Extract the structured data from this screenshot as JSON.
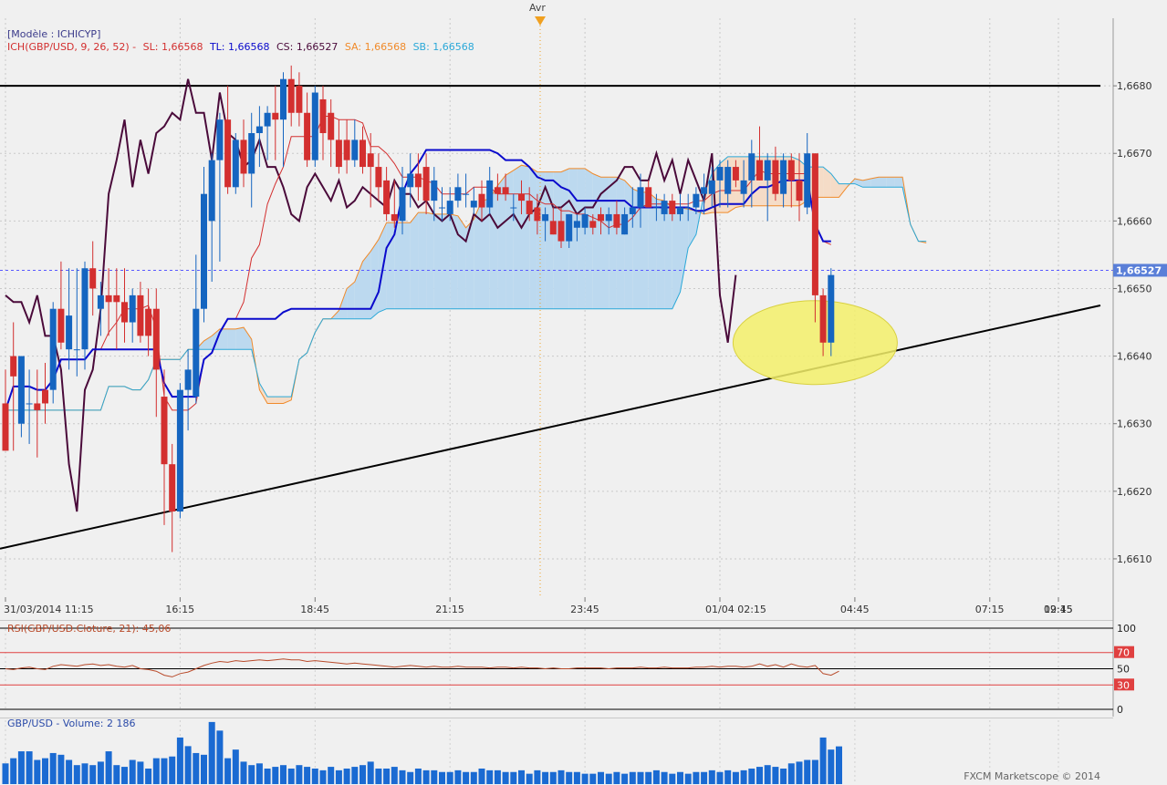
{
  "header": {
    "month_marker": "Avr",
    "model_label": "[Modèle : ICHICYP]",
    "ichimoku_legend": {
      "name": "ICH(GBP/USD, 9, 26, 52) -",
      "sl": "SL: 1,66568",
      "tl": "TL: 1,66568",
      "cs": "CS: 1,66527",
      "sa": "SA: 1,66568",
      "sb": "SB: 1,66568"
    }
  },
  "colors": {
    "bull": "#1565c0",
    "bear": "#d32f2f",
    "sl": "#d32f2f",
    "tl": "#0a0acc",
    "cs": "#4a0a3a",
    "sa": "#f08a2a",
    "sb": "#2aa8d8",
    "cloud_bull": "#bcd9ef",
    "cloud_bear": "#f5dcc7",
    "highlight": "#f3f06a",
    "rsi": "#b84a2a",
    "volume": "#1a6ad2"
  },
  "chart_data": [
    {
      "type": "candlestick",
      "title": "GBP/USD",
      "ylim": [
        1.6605,
        1.669
      ],
      "y_ticks": [
        "1,6610",
        "1,6620",
        "1,6630",
        "1,6640",
        "1,6650",
        "1,6660",
        "1,6670",
        "1,6680"
      ],
      "x_tick_labels": [
        "31/03/2014 11:15",
        "16:15",
        "18:45",
        "21:15",
        "23:45",
        "01/04 02:15",
        "04:45",
        "07:15",
        "09:45",
        "12:15"
      ],
      "current_price_label": "1,66527",
      "current_price": 1.66527,
      "ohlc": [
        [
          1.6633,
          1.6638,
          1.6626,
          1.6626
        ],
        [
          1.664,
          1.6645,
          1.6626,
          1.6637
        ],
        [
          1.663,
          1.664,
          1.6628,
          1.664
        ],
        [
          1.6633,
          1.6638,
          1.6627,
          1.6633
        ],
        [
          1.6633,
          1.6638,
          1.6625,
          1.6632
        ],
        [
          1.6635,
          1.6639,
          1.663,
          1.6633
        ],
        [
          1.6635,
          1.6648,
          1.6633,
          1.6647
        ],
        [
          1.6647,
          1.6654,
          1.6641,
          1.6642
        ],
        [
          1.6641,
          1.6653,
          1.6638,
          1.6646
        ],
        [
          1.6641,
          1.6653,
          1.6637,
          1.6641
        ],
        [
          1.6641,
          1.6654,
          1.6638,
          1.6653
        ],
        [
          1.6653,
          1.6657,
          1.6646,
          1.665
        ],
        [
          1.6647,
          1.6651,
          1.6643,
          1.6649
        ],
        [
          1.6649,
          1.6653,
          1.6643,
          1.6648
        ],
        [
          1.6649,
          1.6653,
          1.6641,
          1.6648
        ],
        [
          1.6648,
          1.6653,
          1.6642,
          1.6645
        ],
        [
          1.6645,
          1.665,
          1.6642,
          1.6649
        ],
        [
          1.6649,
          1.6651,
          1.6642,
          1.6643
        ],
        [
          1.6647,
          1.665,
          1.664,
          1.6643
        ],
        [
          1.6647,
          1.665,
          1.6631,
          1.6638
        ],
        [
          1.6634,
          1.6638,
          1.6615,
          1.6624
        ],
        [
          1.6624,
          1.6627,
          1.6611,
          1.6617
        ],
        [
          1.6617,
          1.6636,
          1.6616,
          1.6635
        ],
        [
          1.6635,
          1.6641,
          1.6629,
          1.6638
        ],
        [
          1.6634,
          1.6655,
          1.6633,
          1.6647
        ],
        [
          1.6647,
          1.6668,
          1.6645,
          1.6664
        ],
        [
          1.666,
          1.667,
          1.6651,
          1.6669
        ],
        [
          1.6669,
          1.6676,
          1.6654,
          1.6675
        ],
        [
          1.6675,
          1.668,
          1.6664,
          1.6665
        ],
        [
          1.6665,
          1.6673,
          1.6664,
          1.6672
        ],
        [
          1.6672,
          1.6675,
          1.6665,
          1.6667
        ],
        [
          1.6667,
          1.6676,
          1.6662,
          1.6673
        ],
        [
          1.6673,
          1.6677,
          1.6668,
          1.6674
        ],
        [
          1.6674,
          1.6677,
          1.6669,
          1.6676
        ],
        [
          1.6676,
          1.668,
          1.6669,
          1.6675
        ],
        [
          1.6675,
          1.6682,
          1.6668,
          1.6681
        ],
        [
          1.6681,
          1.6683,
          1.6674,
          1.6676
        ],
        [
          1.668,
          1.6682,
          1.6674,
          1.6676
        ],
        [
          1.6676,
          1.6679,
          1.6668,
          1.6669
        ],
        [
          1.6669,
          1.668,
          1.6668,
          1.6679
        ],
        [
          1.6678,
          1.668,
          1.6669,
          1.6673
        ],
        [
          1.6676,
          1.6678,
          1.6668,
          1.6672
        ],
        [
          1.6672,
          1.6675,
          1.6667,
          1.6668
        ],
        [
          1.6672,
          1.6675,
          1.6667,
          1.6669
        ],
        [
          1.6669,
          1.6675,
          1.6668,
          1.6672
        ],
        [
          1.6672,
          1.6674,
          1.6667,
          1.6668
        ],
        [
          1.667,
          1.6673,
          1.6662,
          1.6668
        ],
        [
          1.6668,
          1.667,
          1.6663,
          1.6665
        ],
        [
          1.6666,
          1.6668,
          1.666,
          1.6661
        ],
        [
          1.6661,
          1.6666,
          1.6659,
          1.666
        ],
        [
          1.666,
          1.6668,
          1.6658,
          1.6665
        ],
        [
          1.6665,
          1.667,
          1.6662,
          1.6667
        ],
        [
          1.6667,
          1.667,
          1.6663,
          1.6665
        ],
        [
          1.6668,
          1.667,
          1.6661,
          1.6663
        ],
        [
          1.6663,
          1.6668,
          1.666,
          1.6666
        ],
        [
          1.6662,
          1.6665,
          1.666,
          1.6662
        ],
        [
          1.6661,
          1.6665,
          1.666,
          1.6663
        ],
        [
          1.6663,
          1.6667,
          1.6662,
          1.6665
        ],
        [
          1.6664,
          1.6667,
          1.6662,
          1.6664
        ],
        [
          1.6662,
          1.6665,
          1.6661,
          1.6663
        ],
        [
          1.6664,
          1.6666,
          1.666,
          1.6662
        ],
        [
          1.6662,
          1.6668,
          1.6661,
          1.6666
        ],
        [
          1.6665,
          1.6667,
          1.6663,
          1.6664
        ],
        [
          1.6665,
          1.6667,
          1.6663,
          1.6664
        ],
        [
          1.6662,
          1.6664,
          1.666,
          1.6662
        ],
        [
          1.6664,
          1.6666,
          1.6661,
          1.6663
        ],
        [
          1.6663,
          1.6665,
          1.666,
          1.6661
        ],
        [
          1.6662,
          1.6664,
          1.6658,
          1.666
        ],
        [
          1.666,
          1.6662,
          1.6657,
          1.6661
        ],
        [
          1.666,
          1.6662,
          1.6658,
          1.6658
        ],
        [
          1.666,
          1.6662,
          1.6656,
          1.6657
        ],
        [
          1.6657,
          1.6661,
          1.6656,
          1.6661
        ],
        [
          1.6659,
          1.6661,
          1.6657,
          1.666
        ],
        [
          1.6659,
          1.6662,
          1.6658,
          1.6661
        ],
        [
          1.666,
          1.6661,
          1.6658,
          1.6659
        ],
        [
          1.6661,
          1.6662,
          1.6658,
          1.666
        ],
        [
          1.666,
          1.6662,
          1.6658,
          1.6661
        ],
        [
          1.6661,
          1.6663,
          1.6658,
          1.6659
        ],
        [
          1.6658,
          1.6662,
          1.6658,
          1.6661
        ],
        [
          1.6661,
          1.6665,
          1.6659,
          1.6662
        ],
        [
          1.6662,
          1.6667,
          1.6659,
          1.6665
        ],
        [
          1.6665,
          1.6666,
          1.6662,
          1.6662
        ],
        [
          1.6662,
          1.6664,
          1.666,
          1.6662
        ],
        [
          1.6661,
          1.6664,
          1.666,
          1.6663
        ],
        [
          1.6663,
          1.6664,
          1.666,
          1.6661
        ],
        [
          1.6661,
          1.6664,
          1.666,
          1.6662
        ],
        [
          1.6662,
          1.6664,
          1.666,
          1.6662
        ],
        [
          1.6662,
          1.6665,
          1.6661,
          1.6664
        ],
        [
          1.6664,
          1.6667,
          1.6661,
          1.6665
        ],
        [
          1.6664,
          1.6668,
          1.6662,
          1.6666
        ],
        [
          1.6666,
          1.6669,
          1.6662,
          1.6668
        ],
        [
          1.6664,
          1.6669,
          1.6662,
          1.6668
        ],
        [
          1.6668,
          1.6669,
          1.6665,
          1.6666
        ],
        [
          1.6664,
          1.6669,
          1.6662,
          1.6666
        ],
        [
          1.6666,
          1.6672,
          1.6662,
          1.667
        ],
        [
          1.6669,
          1.6674,
          1.6666,
          1.6666
        ],
        [
          1.6666,
          1.667,
          1.666,
          1.6669
        ],
        [
          1.6669,
          1.6671,
          1.6663,
          1.6664
        ],
        [
          1.6664,
          1.667,
          1.6662,
          1.6669
        ],
        [
          1.6669,
          1.667,
          1.6662,
          1.6666
        ],
        [
          1.6666,
          1.667,
          1.666,
          1.6663
        ],
        [
          1.6662,
          1.6673,
          1.6661,
          1.667
        ],
        [
          1.667,
          1.667,
          1.6645,
          1.6649
        ],
        [
          1.6649,
          1.665,
          1.664,
          1.6642
        ],
        [
          1.6642,
          1.6653,
          1.664,
          1.6652
        ]
      ]
    },
    {
      "type": "line",
      "title": "RSI(GBP/USD.Cloture, 21): 45,06",
      "ylim": [
        0,
        100
      ],
      "y_ticks": [
        "100",
        "70",
        "50",
        "30",
        "0"
      ],
      "levels": [
        70,
        50,
        30
      ],
      "values": [
        50,
        49,
        51,
        52,
        50,
        49,
        53,
        55,
        54,
        53,
        55,
        56,
        54,
        55,
        53,
        52,
        54,
        50,
        49,
        47,
        42,
        40,
        44,
        46,
        50,
        54,
        57,
        59,
        58,
        60,
        59,
        60,
        61,
        60,
        61,
        62,
        61,
        61,
        59,
        60,
        59,
        58,
        57,
        56,
        57,
        56,
        55,
        54,
        53,
        52,
        53,
        54,
        53,
        52,
        53,
        52,
        52,
        53,
        52,
        52,
        52,
        51,
        52,
        52,
        51,
        52,
        51,
        51,
        50,
        51,
        50,
        50,
        51,
        51,
        51,
        51,
        50,
        51,
        51,
        51,
        52,
        51,
        51,
        52,
        51,
        51,
        51,
        52,
        52,
        53,
        52,
        53,
        53,
        52,
        53,
        56,
        53,
        55,
        52,
        56,
        53,
        52,
        54,
        44,
        42,
        47
      ]
    },
    {
      "type": "bar",
      "title": "GBP/USD - Volume: 2 186",
      "values": [
        1200,
        1500,
        1900,
        1900,
        1400,
        1500,
        1800,
        1700,
        1400,
        1100,
        1200,
        1100,
        1300,
        1900,
        1100,
        1000,
        1400,
        1300,
        900,
        1500,
        1500,
        1600,
        2700,
        2200,
        1800,
        1700,
        3600,
        3100,
        1500,
        2000,
        1300,
        1100,
        1200,
        900,
        1000,
        1100,
        900,
        1100,
        1000,
        900,
        800,
        1000,
        800,
        900,
        1000,
        1100,
        1300,
        900,
        900,
        1000,
        800,
        700,
        900,
        800,
        800,
        700,
        700,
        800,
        700,
        700,
        900,
        800,
        800,
        700,
        700,
        800,
        600,
        800,
        700,
        700,
        800,
        700,
        700,
        600,
        600,
        700,
        600,
        700,
        600,
        700,
        700,
        700,
        800,
        700,
        600,
        700,
        600,
        700,
        700,
        800,
        700,
        800,
        700,
        800,
        900,
        1000,
        1100,
        1000,
        900,
        1200,
        1300,
        1400,
        1400,
        2700,
        2000,
        2186
      ]
    }
  ],
  "copyright": "FXCM Marketscope © 2014"
}
